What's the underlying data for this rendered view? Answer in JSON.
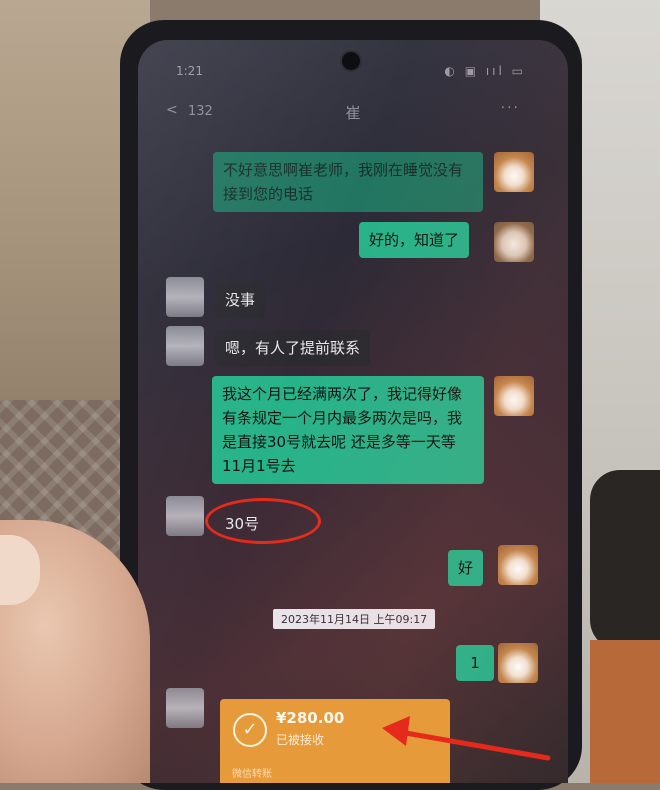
{
  "status_bar": {
    "time": "1:21",
    "icons": "◐ ▣ ııl ▭"
  },
  "header": {
    "back_count": "132",
    "title": "崔",
    "more": "···"
  },
  "messages": {
    "m1": "不好意思啊崔老师，我刚在睡觉没有接到您的电话",
    "m2": "好的，知道了",
    "m3": "没事",
    "m4": "嗯，有人了提前联系",
    "m5": "我这个月已经满两次了，我记得好像有条规定一个月内最多两次是吗，我是直接30号就去呢 还是多等一天等11月1号去",
    "m6": "30号",
    "m7": "好",
    "timestamp": "2023年11月14日 上午09:17",
    "m8": "1"
  },
  "transfer": {
    "amount": "¥280.00",
    "status": "已被接收",
    "footer": "微信转账"
  },
  "colors": {
    "sent_bubble": "#27b38a",
    "received_bubble": "#2a2a30",
    "transfer": "#e79a3a",
    "annotation": "#e52a1c"
  }
}
